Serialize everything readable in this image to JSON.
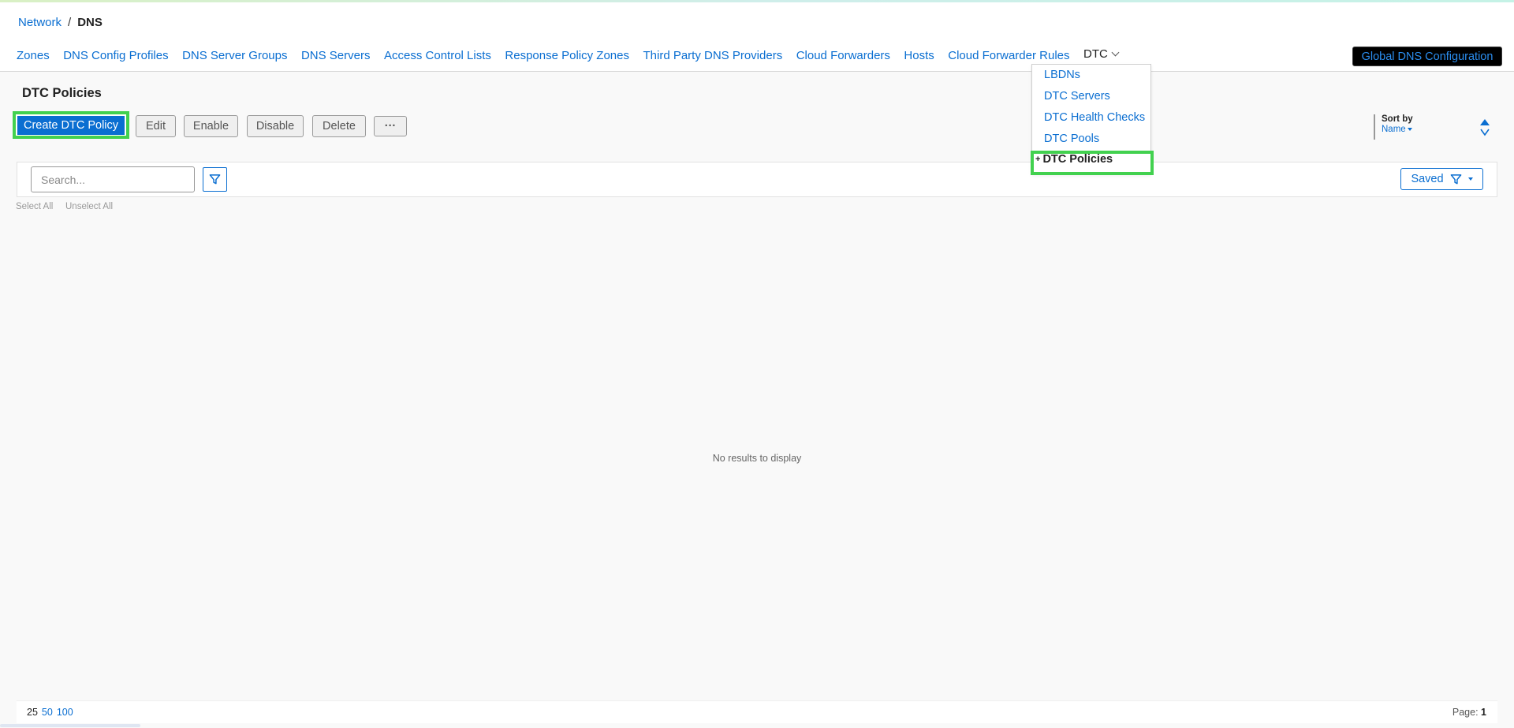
{
  "breadcrumb": {
    "network": "Network",
    "separator": "/",
    "current": "DNS"
  },
  "nav": {
    "items": [
      "Zones",
      "DNS Config Profiles",
      "DNS Server Groups",
      "DNS Servers",
      "Access Control Lists",
      "Response Policy Zones",
      "Third Party DNS Providers",
      "Cloud Forwarders",
      "Hosts",
      "Cloud Forwarder Rules"
    ],
    "dtc_label": "DTC",
    "global_button": "Global DNS Configuration"
  },
  "dtc_menu": {
    "items": [
      "LBDNs",
      "DTC Servers",
      "DTC Health Checks",
      "DTC Pools"
    ],
    "current": "DTC Policies",
    "current_prefix": "+"
  },
  "page": {
    "title": "DTC Policies"
  },
  "toolbar": {
    "create": "Create DTC Policy",
    "edit": "Edit",
    "enable": "Enable",
    "disable": "Disable",
    "delete": "Delete",
    "more": "···"
  },
  "sort": {
    "label": "Sort by",
    "value": "Name"
  },
  "filter": {
    "search_placeholder": "Search...",
    "saved_label": "Saved",
    "select_all": "Select All",
    "unselect_all": "Unselect All"
  },
  "results": {
    "empty_message": "No results to display"
  },
  "pagination": {
    "sizes": [
      "25",
      "50",
      "100"
    ],
    "page_label": "Page:",
    "page_number": "1"
  },
  "colors": {
    "accent": "#0a6ed1",
    "highlight": "#42d14f",
    "global_bg": "#000000"
  }
}
